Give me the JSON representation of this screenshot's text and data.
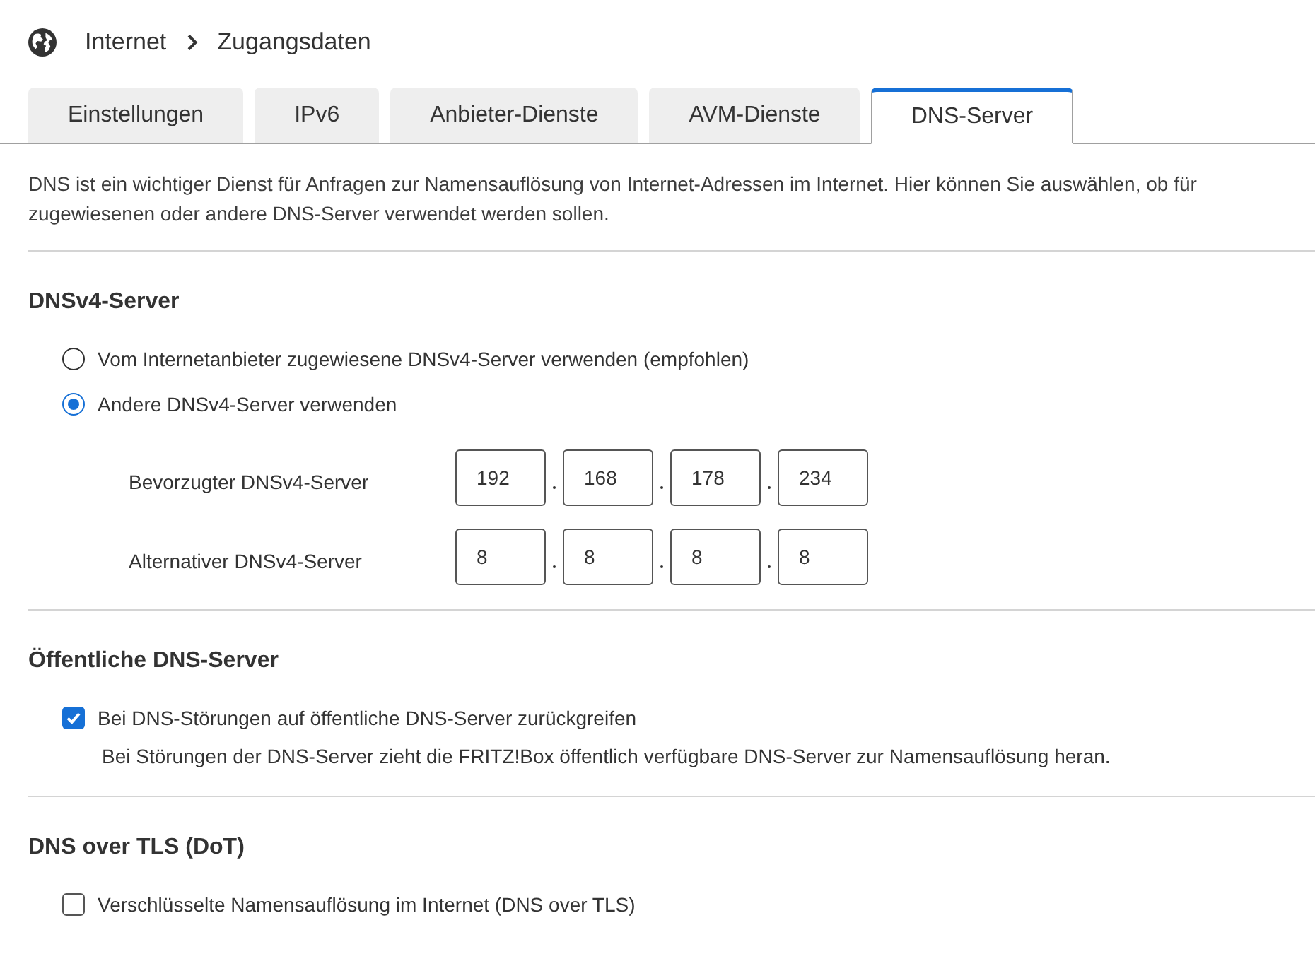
{
  "breadcrumb": [
    "Internet",
    "Zugangsdaten"
  ],
  "tabs": [
    {
      "label": "Einstellungen",
      "selected": false
    },
    {
      "label": "IPv6",
      "selected": false
    },
    {
      "label": "Anbieter-Dienste",
      "selected": false
    },
    {
      "label": "AVM-Dienste",
      "selected": false
    },
    {
      "label": "DNS-Server",
      "selected": true
    }
  ],
  "description": "DNS ist ein wichtiger Dienst für Anfragen zur Namensauflösung von Internet-Adressen im Internet. Hier können Sie auswählen, ob für zugewiesenen oder andere DNS-Server verwendet werden sollen.",
  "dnsv4": {
    "title": "DNSv4-Server",
    "options": [
      {
        "label": "Vom Internetanbieter zugewiesene DNSv4-Server verwenden (empfohlen)",
        "selected": false
      },
      {
        "label": "Andere DNSv4-Server verwenden",
        "selected": true
      }
    ],
    "servers": [
      {
        "label": "Bevorzugter DNSv4-Server",
        "octets": [
          "192",
          "168",
          "178",
          "234"
        ]
      },
      {
        "label": "Alternativer DNSv4-Server",
        "octets": [
          "8",
          "8",
          "8",
          "8"
        ]
      }
    ]
  },
  "public_dns": {
    "title": "Öffentliche DNS-Server",
    "option": {
      "label": "Bei DNS-Störungen auf öffentliche DNS-Server zurückgreifen",
      "checked": true
    },
    "hint": "Bei Störungen der DNS-Server zieht die FRITZ!Box öffentlich verfügbare DNS-Server zur Namensauflösung heran."
  },
  "dot": {
    "title": "DNS over TLS (DoT)",
    "option": {
      "label": "Verschlüsselte Namensauflösung im Internet (DNS over TLS)",
      "checked": false
    }
  }
}
